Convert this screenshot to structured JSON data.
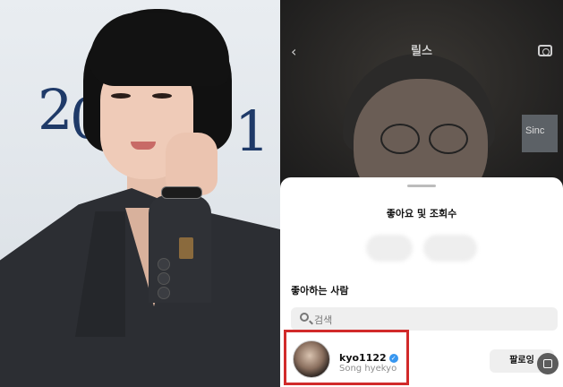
{
  "left_photo": {
    "backdrop_text_1": "2",
    "backdrop_text_2": "0",
    "backdrop_text_3": "1"
  },
  "phone": {
    "header": {
      "back_icon": "chevron-left-icon",
      "title": "릴스",
      "camera_icon": "camera-icon"
    },
    "video": {
      "sign_text": "Sinc"
    },
    "sheet": {
      "title": "좋아요 및 조회수",
      "section_label": "좋아하는 사람",
      "search": {
        "icon": "search-icon",
        "placeholder": "검색"
      },
      "likers": [
        {
          "username": "kyo1122",
          "verified": true,
          "full_name": "Song hyekyo",
          "follow_label": "팔로잉"
        }
      ],
      "highlight_color": "#d12a2a"
    }
  },
  "colors": {
    "verified_badge": "#3897f0",
    "sheet_bg": "#ffffff",
    "search_bg": "#efefef"
  }
}
